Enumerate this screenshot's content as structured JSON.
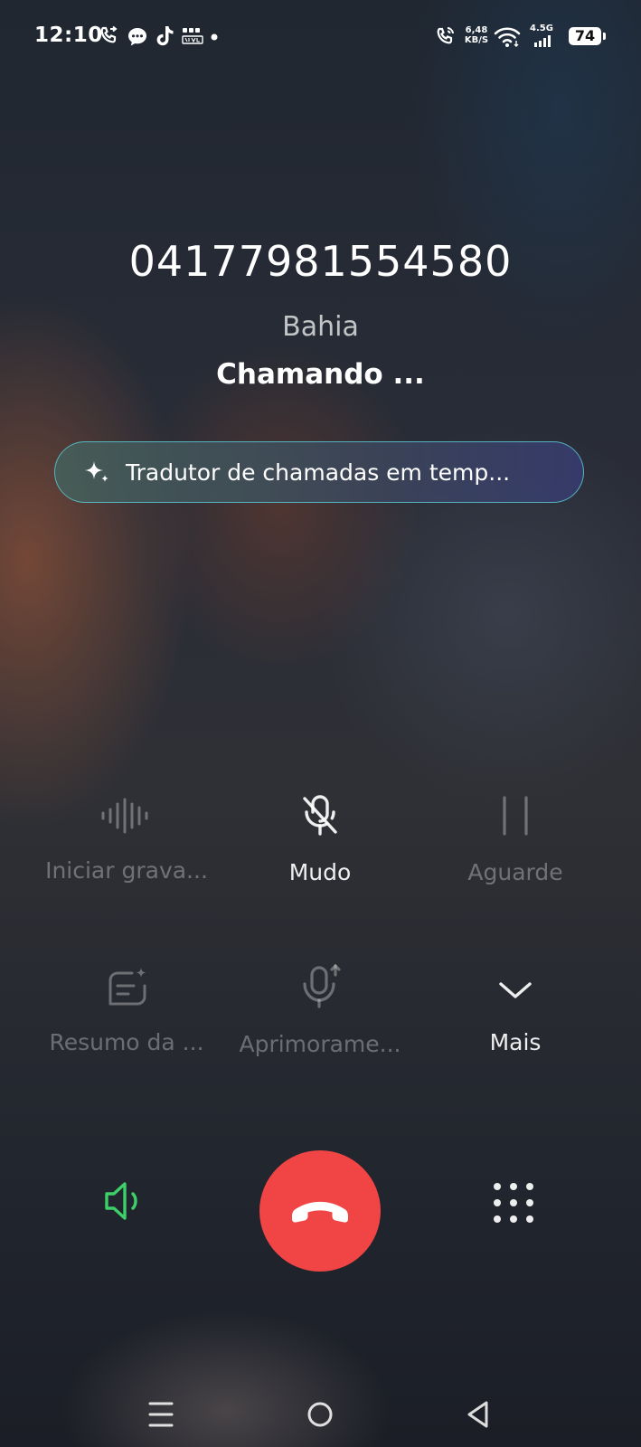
{
  "status_bar": {
    "time": "12:10",
    "left_icons": [
      "call-forward-icon",
      "chat-bubble-icon",
      "tiktok-icon",
      "temu-icon",
      "notification-dot-icon"
    ],
    "net_speed_value": "6,48",
    "net_speed_unit": "KB/S",
    "network_type": "4.5G",
    "battery_level": "74",
    "right_icons": [
      "wifi-calling-icon",
      "wifi-icon",
      "signal-bars-icon",
      "battery-icon"
    ]
  },
  "call": {
    "number": "04177981554580",
    "location": "Bahia",
    "status": "Chamando ..."
  },
  "translator": {
    "label": "Tradutor de chamadas em temp...",
    "icon": "sparkle-icon"
  },
  "controls": {
    "record_label": "Iniciar grava...",
    "mute_label": "Mudo",
    "hold_label": "Aguarde",
    "summary_label": "Resumo da ...",
    "enhance_label": "Aprimorame...",
    "more_label": "Mais"
  },
  "colors": {
    "end_call": "#f14545",
    "speaker": "#3ecf6a",
    "translator_border": "#5ac8d2"
  }
}
